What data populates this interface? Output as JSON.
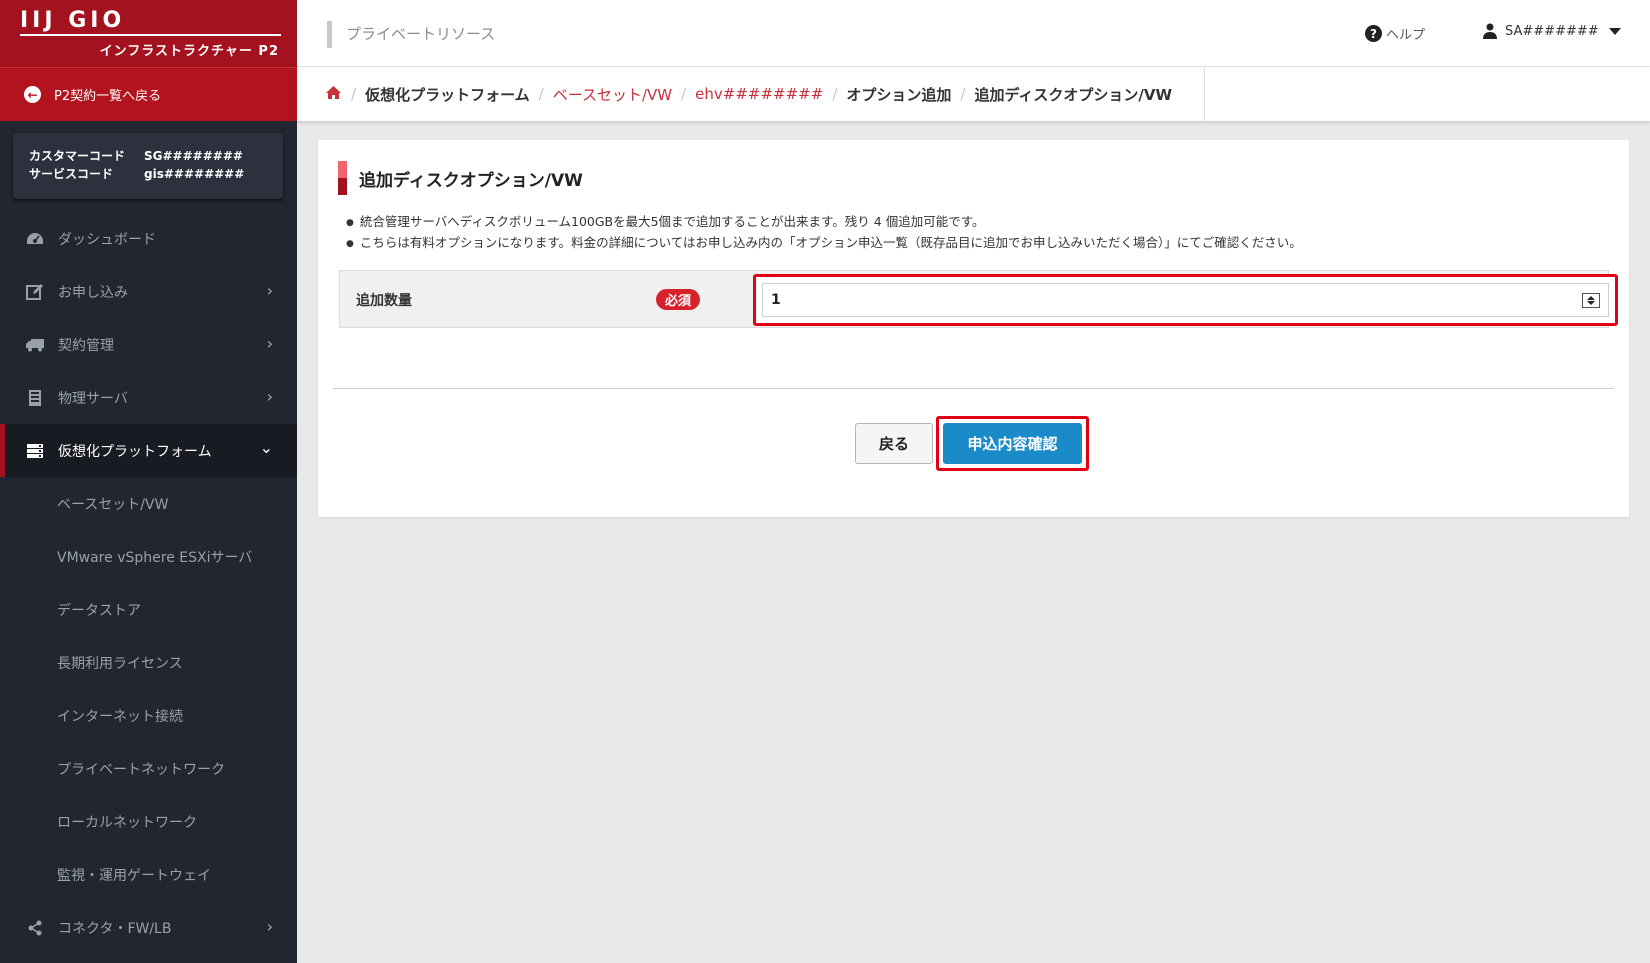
{
  "brand": {
    "logo_text": "IIJ GIO",
    "subtitle": "インフラストラクチャー P2"
  },
  "sidebar": {
    "back_label": "P2契約一覧へ戻る",
    "customer_code_label": "カスタマーコード",
    "customer_code_value": "SG########",
    "service_code_label": "サービスコード",
    "service_code_value": "gis########",
    "items": [
      {
        "label": "ダッシュボード",
        "icon": "dashboard-icon"
      },
      {
        "label": "お申し込み",
        "icon": "edit-icon"
      },
      {
        "label": "契約管理",
        "icon": "truck-icon"
      },
      {
        "label": "物理サーバ",
        "icon": "server-icon"
      },
      {
        "label": "仮想化プラットフォーム",
        "icon": "stack-icon"
      },
      {
        "label": "コネクタ・FW/LB",
        "icon": "share-icon"
      }
    ],
    "sub_items": [
      "ベースセット/VW",
      "VMware vSphere ESXiサーバ",
      "データストア",
      "長期利用ライセンス",
      "インターネット接続",
      "プライベートネットワーク",
      "ローカルネットワーク",
      "監視・運用ゲートウェイ"
    ]
  },
  "header": {
    "section": "プライベートリソース",
    "help_label": "ヘルプ",
    "user_name": "SA#######"
  },
  "breadcrumb": {
    "items": [
      "仮想化プラットフォーム",
      "ベースセット/VW",
      "ehv########",
      "オプション追加",
      "追加ディスクオプション/VW"
    ]
  },
  "panel": {
    "title": "追加ディスクオプション/VW",
    "note1": "統合管理サーバへディスクボリューム100GBを最大5個まで追加することが出来ます。残り 4 個追加可能です。",
    "note2": "こちらは有料オプションになります。料金の詳細についてはお申し込み内の「オプション申込一覧（既存品目に追加でお申し込みいただく場合）」にてご確認ください。",
    "field_label": "追加数量",
    "required_badge": "必須",
    "quantity_value": "1",
    "back_button": "戻る",
    "submit_button": "申込内容確認"
  },
  "colors": {
    "brand_red": "#a5121f",
    "sidebar_bg": "#212631",
    "primary_blue": "#1a8ac9",
    "highlight_red": "#e10014"
  }
}
